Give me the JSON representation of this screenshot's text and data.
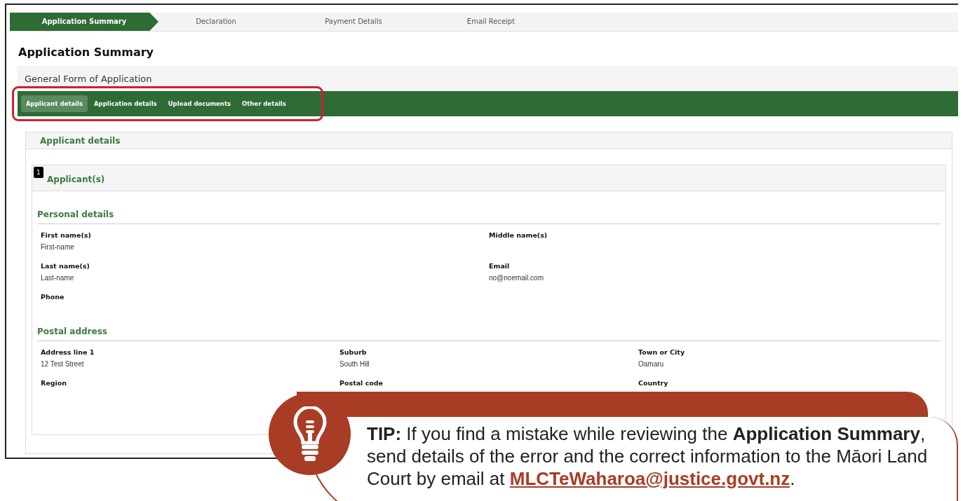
{
  "steps": [
    {
      "label": "Application Summary",
      "selected": true
    },
    {
      "label": "Declaration",
      "selected": false
    },
    {
      "label": "Payment Details",
      "selected": false
    },
    {
      "label": "Email Receipt",
      "selected": false
    }
  ],
  "page_title": "Application Summary",
  "form_title": "General Form of Application",
  "tabs": [
    {
      "label": "Applicant details",
      "selected": true
    },
    {
      "label": "Application details",
      "selected": false
    },
    {
      "label": "Upload documents",
      "selected": false
    },
    {
      "label": "Other details",
      "selected": false
    }
  ],
  "section_title": "Applicant details",
  "applicants": {
    "count": "1",
    "title": "Applicant(s)"
  },
  "groups": [
    {
      "title": "Personal details",
      "fields": [
        {
          "label": "First name(s)",
          "value": "First-name"
        },
        {
          "label": "Middle name(s)"
        },
        {
          "label": "Last name(s)",
          "value": "Last-name"
        },
        {
          "label": "Email",
          "value": "no@noemail.com"
        },
        {
          "label": "Phone"
        }
      ]
    },
    {
      "title": "Postal address",
      "fields": [
        {
          "label": "Address line 1",
          "value": "12 Test Street"
        },
        {
          "label": "Suburb",
          "value": "South Hill"
        },
        {
          "label": "Town or City",
          "value": "Oamaru"
        },
        {
          "label": "Region"
        },
        {
          "label": "Postal code"
        },
        {
          "label": "Country"
        }
      ]
    }
  ],
  "tip": {
    "text": "**TIP:** If you find a mistake while reviewing the **Application Summary**, send details of the error and the correct information to the Māori Land Court by email at ",
    "link": "MLCTeWaharoa@justice.govt.nz",
    "text_after": "."
  }
}
